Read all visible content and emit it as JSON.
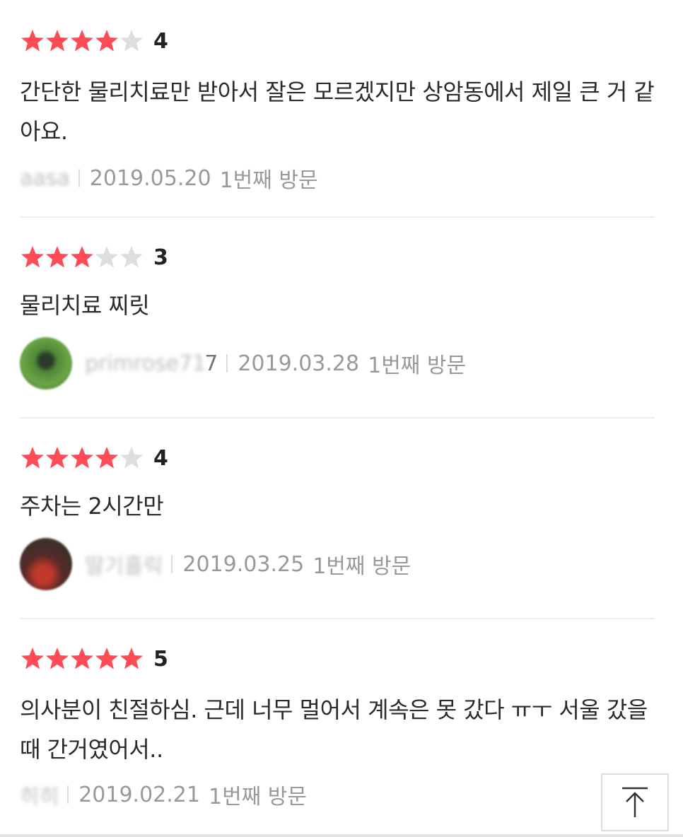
{
  "colors": {
    "star_on": "#ff4b55",
    "star_off": "#dedede",
    "text": "#2a2a2a",
    "meta": "#999999"
  },
  "reviews": [
    {
      "rating": 4,
      "score_label": "4",
      "text": "간단한 물리치료만 받아서 잘은 모르겠지만 상암동에서 제일 큰 거 같아요.",
      "nickname": "aasa",
      "nickname_tail": "",
      "date": "2019.05.20",
      "visit": "1번째 방문",
      "avatar": null
    },
    {
      "rating": 3,
      "score_label": "3",
      "text": "물리치료 찌릿",
      "nickname": "primrose71",
      "nickname_tail": "7",
      "date": "2019.03.28",
      "visit": "1번째 방문",
      "avatar": "green-leaf-avatar"
    },
    {
      "rating": 4,
      "score_label": "4",
      "text": "주차는 2시간만",
      "nickname": "딸기홀릭",
      "nickname_tail": "",
      "date": "2019.03.25",
      "visit": "1번째 방문",
      "avatar": "strawberry-avatar"
    },
    {
      "rating": 5,
      "score_label": "5",
      "text": "의사분이 친절하심. 근데 너무 멀어서 계속은 못 갔다 ㅠㅜ 서울 갔을때 간거였어서..",
      "nickname": "히히",
      "nickname_tail": "",
      "date": "2019.02.21",
      "visit": "1번째 방문",
      "avatar": null
    }
  ],
  "scroll_top_button": {
    "icon": "arrow-up-to-top-icon"
  }
}
